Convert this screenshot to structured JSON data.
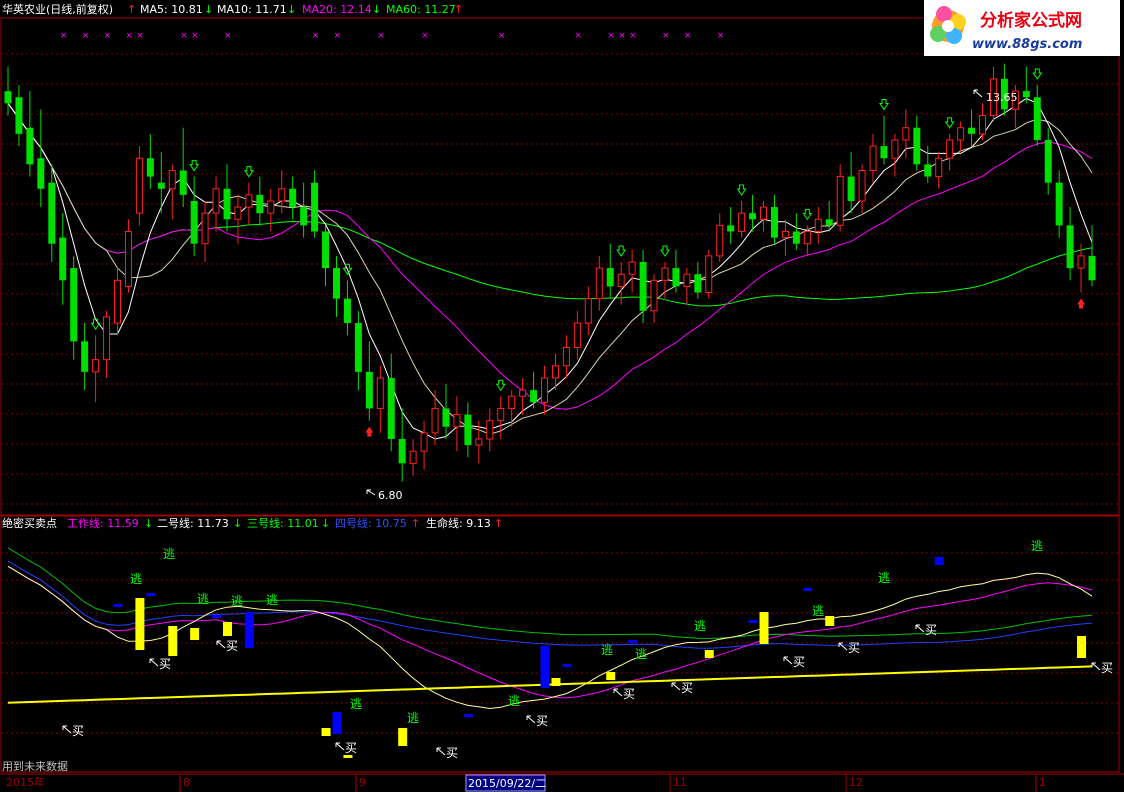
{
  "top_panel": {
    "title": "华英农业(日线,前复权)",
    "ma_items": [
      {
        "label": "MA5: 10.81",
        "arrow": "down",
        "color": "#ffffff"
      },
      {
        "label": "MA10: 11.71",
        "arrow": "down",
        "color": "#ffffff"
      },
      {
        "label": "MA20: 12.14",
        "arrow": "down",
        "color": "#ff00ff"
      },
      {
        "label": "MA60: 11.27",
        "arrow": "up",
        "color": "#00ff00"
      }
    ],
    "high_label": "13.65",
    "low_label": "6.80"
  },
  "bottom_panel": {
    "title": "绝密买卖点",
    "items": [
      {
        "label": "工作线: 11.59",
        "arrow": "down",
        "color": "#ff00ff"
      },
      {
        "label": "二号线: 11.73",
        "arrow": "down",
        "color": "#ffffff"
      },
      {
        "label": "三号线: 11.01",
        "arrow": "down",
        "color": "#00ff00"
      },
      {
        "label": "四号线: 10.75",
        "arrow": "up",
        "color": "#0000ff"
      },
      {
        "label": "生命线: 9.13",
        "arrow": "up",
        "color": "#ffffff"
      }
    ],
    "buy_text": "买",
    "escape_text": "逃"
  },
  "footer_note": "用到未来数据",
  "time_axis": [
    {
      "label": "2015年"
    },
    {
      "label": "8"
    },
    {
      "label": "9"
    },
    {
      "label": "2015/09/22/二",
      "highlight": true
    },
    {
      "label": "11"
    },
    {
      "label": "12"
    },
    {
      "label": "1"
    }
  ],
  "watermark": {
    "line1": "分析家公式网",
    "line2": "www.88gs.com"
  },
  "chart_data": {
    "type": "candlestick",
    "price_range": [
      6.5,
      14.3
    ],
    "series": [
      {
        "name": "MA5",
        "color": "#ffffff"
      },
      {
        "name": "MA10",
        "color": "#ffffff"
      },
      {
        "name": "MA20",
        "color": "#ff00ff"
      },
      {
        "name": "MA60",
        "color": "#00ff00"
      }
    ],
    "annotations": [
      {
        "text": "13.65"
      },
      {
        "text": "6.80"
      }
    ],
    "candles": [
      {
        "i": 0,
        "o": 13.2,
        "h": 13.6,
        "l": 12.8,
        "c": 13.0
      },
      {
        "i": 1,
        "o": 13.1,
        "h": 13.3,
        "l": 12.3,
        "c": 12.5
      },
      {
        "i": 2,
        "o": 12.6,
        "h": 13.2,
        "l": 11.8,
        "c": 12.0
      },
      {
        "i": 3,
        "o": 12.1,
        "h": 12.9,
        "l": 11.3,
        "c": 11.6
      },
      {
        "i": 4,
        "o": 11.7,
        "h": 12.0,
        "l": 10.4,
        "c": 10.7
      },
      {
        "i": 5,
        "o": 10.8,
        "h": 11.2,
        "l": 9.7,
        "c": 10.1
      },
      {
        "i": 6,
        "o": 10.3,
        "h": 10.5,
        "l": 8.8,
        "c": 9.1
      },
      {
        "i": 7,
        "o": 9.1,
        "h": 9.4,
        "l": 8.3,
        "c": 8.6
      },
      {
        "i": 8,
        "o": 8.6,
        "h": 9.2,
        "l": 8.1,
        "c": 8.8
      },
      {
        "i": 9,
        "o": 8.8,
        "h": 9.6,
        "l": 8.5,
        "c": 9.5
      },
      {
        "i": 10,
        "o": 9.4,
        "h": 10.3,
        "l": 9.2,
        "c": 10.1
      },
      {
        "i": 11,
        "o": 10.0,
        "h": 11.1,
        "l": 9.9,
        "c": 10.9
      },
      {
        "i": 12,
        "o": 11.2,
        "h": 12.3,
        "l": 11.0,
        "c": 12.1
      },
      {
        "i": 13,
        "o": 12.1,
        "h": 12.5,
        "l": 11.6,
        "c": 11.8
      },
      {
        "i": 14,
        "o": 11.7,
        "h": 12.2,
        "l": 11.2,
        "c": 11.6
      },
      {
        "i": 15,
        "o": 11.6,
        "h": 12.0,
        "l": 11.1,
        "c": 11.9
      },
      {
        "i": 16,
        "o": 11.9,
        "h": 12.6,
        "l": 11.3,
        "c": 11.5
      },
      {
        "i": 17,
        "o": 11.4,
        "h": 11.8,
        "l": 10.5,
        "c": 10.7
      },
      {
        "i": 18,
        "o": 10.7,
        "h": 11.4,
        "l": 10.4,
        "c": 11.2
      },
      {
        "i": 19,
        "o": 11.2,
        "h": 11.8,
        "l": 10.9,
        "c": 11.6
      },
      {
        "i": 20,
        "o": 11.6,
        "h": 12.0,
        "l": 10.9,
        "c": 11.1
      },
      {
        "i": 21,
        "o": 11.1,
        "h": 11.5,
        "l": 10.7,
        "c": 11.3
      },
      {
        "i": 22,
        "o": 11.3,
        "h": 11.7,
        "l": 11.0,
        "c": 11.5
      },
      {
        "i": 23,
        "o": 11.5,
        "h": 11.8,
        "l": 11.0,
        "c": 11.2
      },
      {
        "i": 24,
        "o": 11.2,
        "h": 11.6,
        "l": 10.9,
        "c": 11.4
      },
      {
        "i": 25,
        "o": 11.4,
        "h": 11.9,
        "l": 11.2,
        "c": 11.6
      },
      {
        "i": 26,
        "o": 11.6,
        "h": 11.8,
        "l": 11.1,
        "c": 11.3
      },
      {
        "i": 27,
        "o": 11.3,
        "h": 11.7,
        "l": 10.8,
        "c": 11.0
      },
      {
        "i": 28,
        "o": 11.7,
        "h": 11.9,
        "l": 10.8,
        "c": 10.9
      },
      {
        "i": 29,
        "o": 10.9,
        "h": 11.0,
        "l": 10.0,
        "c": 10.3
      },
      {
        "i": 30,
        "o": 10.3,
        "h": 10.5,
        "l": 9.5,
        "c": 9.8
      },
      {
        "i": 31,
        "o": 9.8,
        "h": 10.1,
        "l": 9.2,
        "c": 9.4
      },
      {
        "i": 32,
        "o": 9.4,
        "h": 9.6,
        "l": 8.3,
        "c": 8.6
      },
      {
        "i": 33,
        "o": 8.6,
        "h": 9.1,
        "l": 7.8,
        "c": 8.0
      },
      {
        "i": 34,
        "o": 8.0,
        "h": 8.7,
        "l": 7.6,
        "c": 8.5
      },
      {
        "i": 35,
        "o": 8.5,
        "h": 8.9,
        "l": 7.3,
        "c": 7.5
      },
      {
        "i": 36,
        "o": 7.5,
        "h": 8.0,
        "l": 6.8,
        "c": 7.1
      },
      {
        "i": 37,
        "o": 7.1,
        "h": 7.5,
        "l": 6.9,
        "c": 7.3
      },
      {
        "i": 38,
        "o": 7.3,
        "h": 7.8,
        "l": 7.0,
        "c": 7.6
      },
      {
        "i": 39,
        "o": 7.6,
        "h": 8.3,
        "l": 7.4,
        "c": 8.0
      },
      {
        "i": 40,
        "o": 8.0,
        "h": 8.4,
        "l": 7.5,
        "c": 7.7
      },
      {
        "i": 41,
        "o": 7.7,
        "h": 8.2,
        "l": 7.3,
        "c": 7.9
      },
      {
        "i": 42,
        "o": 7.9,
        "h": 8.1,
        "l": 7.2,
        "c": 7.4
      },
      {
        "i": 43,
        "o": 7.4,
        "h": 7.8,
        "l": 7.1,
        "c": 7.5
      },
      {
        "i": 44,
        "o": 7.5,
        "h": 8.0,
        "l": 7.3,
        "c": 7.8
      },
      {
        "i": 45,
        "o": 7.8,
        "h": 8.2,
        "l": 7.5,
        "c": 8.0
      },
      {
        "i": 46,
        "o": 8.0,
        "h": 8.3,
        "l": 7.7,
        "c": 8.2
      },
      {
        "i": 47,
        "o": 8.2,
        "h": 8.5,
        "l": 7.9,
        "c": 8.3
      },
      {
        "i": 48,
        "o": 8.3,
        "h": 8.6,
        "l": 8.0,
        "c": 8.1
      },
      {
        "i": 49,
        "o": 8.1,
        "h": 8.7,
        "l": 7.9,
        "c": 8.5
      },
      {
        "i": 50,
        "o": 8.5,
        "h": 8.9,
        "l": 8.3,
        "c": 8.7
      },
      {
        "i": 51,
        "o": 8.7,
        "h": 9.2,
        "l": 8.5,
        "c": 9.0
      },
      {
        "i": 52,
        "o": 9.0,
        "h": 9.6,
        "l": 8.8,
        "c": 9.4
      },
      {
        "i": 53,
        "o": 9.4,
        "h": 10.0,
        "l": 9.2,
        "c": 9.8
      },
      {
        "i": 54,
        "o": 9.8,
        "h": 10.5,
        "l": 9.6,
        "c": 10.3
      },
      {
        "i": 55,
        "o": 10.3,
        "h": 10.7,
        "l": 9.8,
        "c": 10.0
      },
      {
        "i": 56,
        "o": 10.0,
        "h": 10.4,
        "l": 9.7,
        "c": 10.2
      },
      {
        "i": 57,
        "o": 10.2,
        "h": 10.6,
        "l": 9.9,
        "c": 10.4
      },
      {
        "i": 58,
        "o": 10.4,
        "h": 10.6,
        "l": 9.4,
        "c": 9.6
      },
      {
        "i": 59,
        "o": 9.6,
        "h": 10.2,
        "l": 9.4,
        "c": 10.1
      },
      {
        "i": 60,
        "o": 10.1,
        "h": 10.4,
        "l": 9.8,
        "c": 10.3
      },
      {
        "i": 61,
        "o": 10.3,
        "h": 10.6,
        "l": 9.9,
        "c": 10.0
      },
      {
        "i": 62,
        "o": 10.0,
        "h": 10.3,
        "l": 9.7,
        "c": 10.2
      },
      {
        "i": 63,
        "o": 10.2,
        "h": 10.4,
        "l": 9.8,
        "c": 9.9
      },
      {
        "i": 64,
        "o": 9.9,
        "h": 10.6,
        "l": 9.8,
        "c": 10.5
      },
      {
        "i": 65,
        "o": 10.5,
        "h": 11.2,
        "l": 10.4,
        "c": 11.0
      },
      {
        "i": 66,
        "o": 11.0,
        "h": 11.3,
        "l": 10.7,
        "c": 10.9
      },
      {
        "i": 67,
        "o": 10.9,
        "h": 11.4,
        "l": 10.8,
        "c": 11.2
      },
      {
        "i": 68,
        "o": 11.2,
        "h": 11.5,
        "l": 10.9,
        "c": 11.1
      },
      {
        "i": 69,
        "o": 11.1,
        "h": 11.4,
        "l": 10.9,
        "c": 11.3
      },
      {
        "i": 70,
        "o": 11.3,
        "h": 11.5,
        "l": 10.7,
        "c": 10.8
      },
      {
        "i": 71,
        "o": 10.8,
        "h": 11.1,
        "l": 10.5,
        "c": 10.9
      },
      {
        "i": 72,
        "o": 10.9,
        "h": 11.2,
        "l": 10.6,
        "c": 10.7
      },
      {
        "i": 73,
        "o": 10.7,
        "h": 11.0,
        "l": 10.5,
        "c": 10.9
      },
      {
        "i": 74,
        "o": 10.9,
        "h": 11.3,
        "l": 10.7,
        "c": 11.1
      },
      {
        "i": 75,
        "o": 11.1,
        "h": 11.4,
        "l": 10.9,
        "c": 11.0
      },
      {
        "i": 76,
        "o": 11.0,
        "h": 12.0,
        "l": 10.9,
        "c": 11.8
      },
      {
        "i": 77,
        "o": 11.8,
        "h": 12.2,
        "l": 11.2,
        "c": 11.4
      },
      {
        "i": 78,
        "o": 11.4,
        "h": 12.0,
        "l": 11.2,
        "c": 11.9
      },
      {
        "i": 79,
        "o": 11.9,
        "h": 12.5,
        "l": 11.7,
        "c": 12.3
      },
      {
        "i": 80,
        "o": 12.3,
        "h": 12.8,
        "l": 12.0,
        "c": 12.1
      },
      {
        "i": 81,
        "o": 12.1,
        "h": 12.5,
        "l": 11.8,
        "c": 12.4
      },
      {
        "i": 82,
        "o": 12.4,
        "h": 12.9,
        "l": 12.1,
        "c": 12.6
      },
      {
        "i": 83,
        "o": 12.6,
        "h": 12.8,
        "l": 11.9,
        "c": 12.0
      },
      {
        "i": 84,
        "o": 12.0,
        "h": 12.3,
        "l": 11.7,
        "c": 11.8
      },
      {
        "i": 85,
        "o": 11.8,
        "h": 12.2,
        "l": 11.6,
        "c": 12.1
      },
      {
        "i": 86,
        "o": 12.1,
        "h": 12.5,
        "l": 11.9,
        "c": 12.4
      },
      {
        "i": 87,
        "o": 12.4,
        "h": 12.7,
        "l": 12.2,
        "c": 12.6
      },
      {
        "i": 88,
        "o": 12.6,
        "h": 12.9,
        "l": 12.3,
        "c": 12.5
      },
      {
        "i": 89,
        "o": 12.5,
        "h": 13.0,
        "l": 12.4,
        "c": 12.8
      },
      {
        "i": 90,
        "o": 12.8,
        "h": 13.6,
        "l": 12.7,
        "c": 13.4
      },
      {
        "i": 91,
        "o": 13.4,
        "h": 13.65,
        "l": 12.8,
        "c": 12.9
      },
      {
        "i": 92,
        "o": 12.9,
        "h": 13.3,
        "l": 12.6,
        "c": 13.2
      },
      {
        "i": 93,
        "o": 13.2,
        "h": 13.6,
        "l": 13.0,
        "c": 13.1
      },
      {
        "i": 94,
        "o": 13.1,
        "h": 13.3,
        "l": 12.3,
        "c": 12.4
      },
      {
        "i": 95,
        "o": 12.4,
        "h": 12.6,
        "l": 11.5,
        "c": 11.7
      },
      {
        "i": 96,
        "o": 11.7,
        "h": 11.9,
        "l": 10.8,
        "c": 11.0
      },
      {
        "i": 97,
        "o": 11.0,
        "h": 11.3,
        "l": 10.1,
        "c": 10.3
      },
      {
        "i": 98,
        "o": 10.3,
        "h": 10.7,
        "l": 9.9,
        "c": 10.5
      },
      {
        "i": 99,
        "o": 10.5,
        "h": 11.0,
        "l": 10.0,
        "c": 10.1
      }
    ]
  }
}
